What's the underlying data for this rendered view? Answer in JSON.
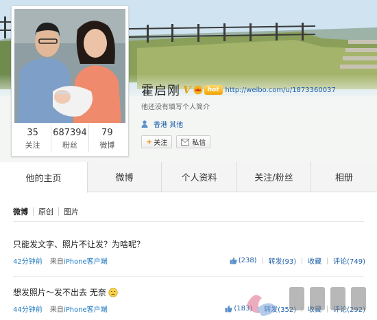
{
  "profile": {
    "name": "霍启刚",
    "verified_badge": "V",
    "vip_badge": "hot",
    "url": "http://weibo.com/u/1873360037",
    "bio": "他还没有填写个人简介",
    "location": "香港 其他",
    "follow_label": "关注",
    "message_label": "私信",
    "follow_icon": "plus-icon",
    "message_icon": "envelope-icon",
    "location_icon": "person-icon"
  },
  "stats": [
    {
      "value": "35",
      "label": "关注"
    },
    {
      "value": "687394",
      "label": "粉丝"
    },
    {
      "value": "79",
      "label": "微博"
    }
  ],
  "tabs": [
    {
      "label": "他的主页",
      "active": true
    },
    {
      "label": "微博",
      "active": false
    },
    {
      "label": "个人资料",
      "active": false
    },
    {
      "label": "关注/粉丝",
      "active": false
    },
    {
      "label": "相册",
      "active": false
    }
  ],
  "filters": [
    {
      "label": "微博",
      "active": true
    },
    {
      "label": "原创",
      "active": false
    },
    {
      "label": "图片",
      "active": false
    }
  ],
  "posts": [
    {
      "text": "只能发文字、照片不让发？为啥呢？",
      "time": "42分钟前",
      "from_prefix": "来自",
      "client": "iPhone客户端",
      "like": "(238)",
      "repost": "转发(93)",
      "favorite": "收藏",
      "comment": "评论(749)"
    },
    {
      "text": "想发照片～发不出去 无奈",
      "time": "44分钟前",
      "from_prefix": "来自",
      "client": "iPhone客户端",
      "like": "(183)",
      "repost": "转发(352)",
      "favorite": "收藏",
      "comment": "评论(292)"
    }
  ],
  "colors": {
    "link": "#1d5fa8",
    "accent_orange": "#f08a00",
    "verified_gold": "#e9a000"
  }
}
